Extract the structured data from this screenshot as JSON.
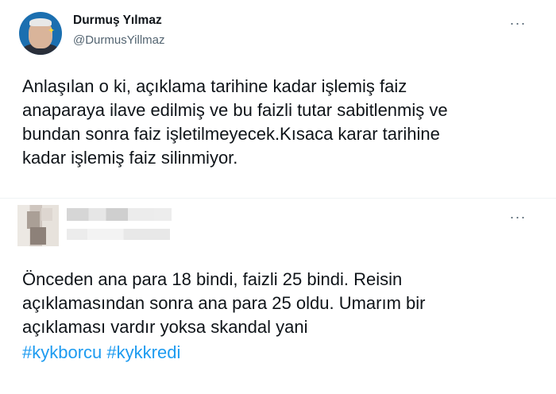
{
  "tweet1": {
    "author_name": "Durmuş Yılmaz",
    "author_handle": "@DurmusYillmaz",
    "more_icon": "more-dots-icon",
    "text": "Anlaşılan o ki,  açıklama tarihine kadar işlemiş faiz\nanaparaya ilave edilmiş ve bu faizli tutar sabitlenmiş ve\nbundan sonra faiz işletilmeyecek.Kısaca karar tarihine\nkadar işlemiş faiz silinmiyor."
  },
  "tweet2": {
    "more_icon": "more-dots-icon",
    "text_lines": [
      "Önceden ana para 18 bindi, faizli 25 bindi. Reisin",
      "açıklamasından sonra ana para 25 oldu. Umarım bir",
      "açıklaması vardır yoksa skandal yani"
    ],
    "hashtags": [
      "#kykborcu",
      "#kykkredi"
    ]
  },
  "colors": {
    "text": "#0f1419",
    "secondary": "#536471",
    "link": "#1d9bf0",
    "divider": "#eff3f4"
  }
}
